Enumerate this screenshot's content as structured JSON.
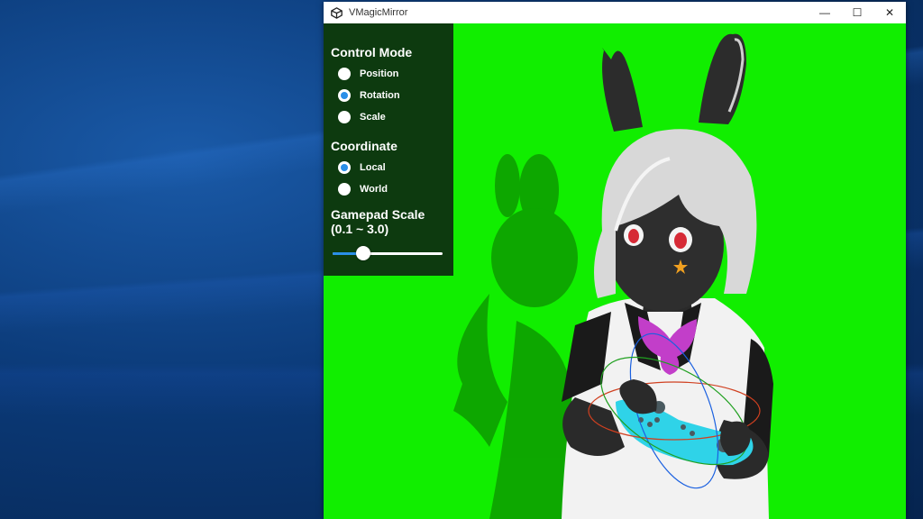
{
  "window": {
    "title": "VMagicMirror",
    "controls": {
      "minimize": "—",
      "maximize": "☐",
      "close": "✕"
    }
  },
  "viewport": {
    "background_color": "#11ee00"
  },
  "panel": {
    "control_mode": {
      "title": "Control Mode",
      "options": [
        "Position",
        "Rotation",
        "Scale"
      ],
      "selected": "Rotation"
    },
    "coordinate": {
      "title": "Coordinate",
      "options": [
        "Local",
        "World"
      ],
      "selected": "Local"
    },
    "gamepad_scale": {
      "title_line1": "Gamepad Scale",
      "title_line2": "(0.1 ~ 3.0)",
      "min": 0.1,
      "max": 3.0,
      "value": 0.9
    }
  },
  "colors": {
    "panel_bg": "#0d3a0f",
    "accent": "#2a8fe8",
    "green_screen": "#11ee00"
  }
}
